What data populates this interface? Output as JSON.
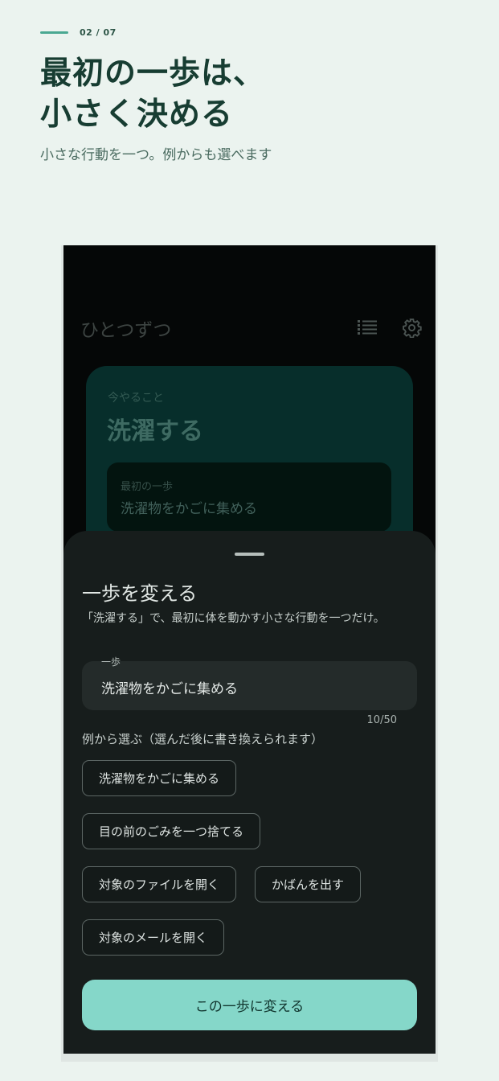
{
  "header": {
    "step_counter": "02 / 07",
    "title": "最初の一歩は、\n小さく決める",
    "subtitle": "小さな行動を一つ。例からも選べます"
  },
  "app": {
    "title": "ひとつずつ",
    "icons": {
      "list": "list-icon",
      "settings": "gear-icon"
    }
  },
  "focus_card": {
    "label": "今やること",
    "task": "洗濯する",
    "step_label": "最初の一歩",
    "step_text": "洗濯物をかごに集める"
  },
  "sheet": {
    "title": "一歩を変える",
    "description": "「洗濯する」で、最初に体を動かす小さな行動を一つだけ。",
    "field_label": "一歩",
    "field_value": "洗濯物をかごに集める",
    "char_counter": "10/50",
    "examples_heading": "例から選ぶ（選んだ後に書き換えられます）",
    "examples": [
      "洗濯物をかごに集める",
      "目の前のごみを一つ捨てる",
      "対象のファイルを開く",
      "かばんを出す",
      "対象のメールを開く"
    ],
    "confirm_label": "この一歩に変える"
  },
  "colors": {
    "accent": "#85d7c9",
    "page_background": "#ebf3ef",
    "sheet_background": "#171d1c",
    "card_background": "#072e2b"
  }
}
